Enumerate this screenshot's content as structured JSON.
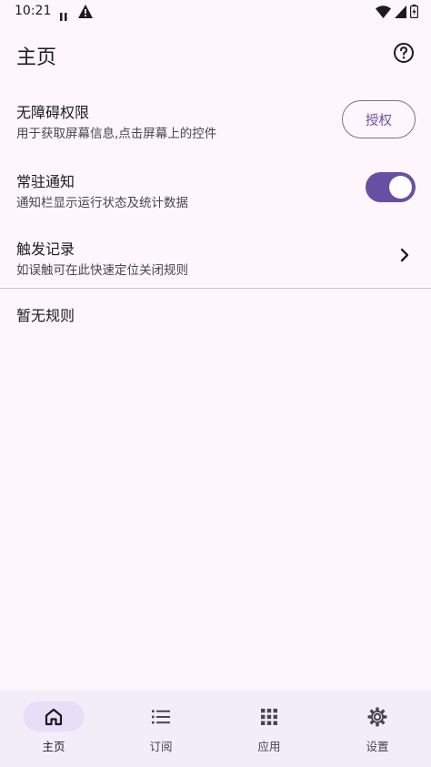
{
  "status_bar": {
    "time": "10:21",
    "icons": [
      "pause-icon",
      "warning-icon",
      "wifi-icon",
      "signal-icon",
      "battery-charging-icon"
    ]
  },
  "top_bar": {
    "title": "主页",
    "help_icon": "help-circle-icon"
  },
  "rows": {
    "accessibility": {
      "title": "无障碍权限",
      "subtitle": "用于获取屏幕信息,点击屏幕上的控件",
      "button_label": "授权"
    },
    "notification": {
      "title": "常驻通知",
      "subtitle": "通知栏显示运行状态及统计数据",
      "toggle_on": true
    },
    "records": {
      "title": "触发记录",
      "subtitle": "如误触可在此快速定位关闭规则",
      "trailing_icon": "chevron-right-icon"
    }
  },
  "empty_state": "暂无规则",
  "bottom_nav": {
    "items": [
      {
        "label": "主页",
        "icon": "home-icon",
        "active": true
      },
      {
        "label": "订阅",
        "icon": "list-icon",
        "active": false
      },
      {
        "label": "应用",
        "icon": "apps-grid-icon",
        "active": false
      },
      {
        "label": "设置",
        "icon": "gear-icon",
        "active": false
      }
    ]
  },
  "colors": {
    "background": "#fdf7fd",
    "accent": "#6750a4",
    "nav_background": "#f3edf7",
    "nav_indicator": "#e8def8"
  }
}
